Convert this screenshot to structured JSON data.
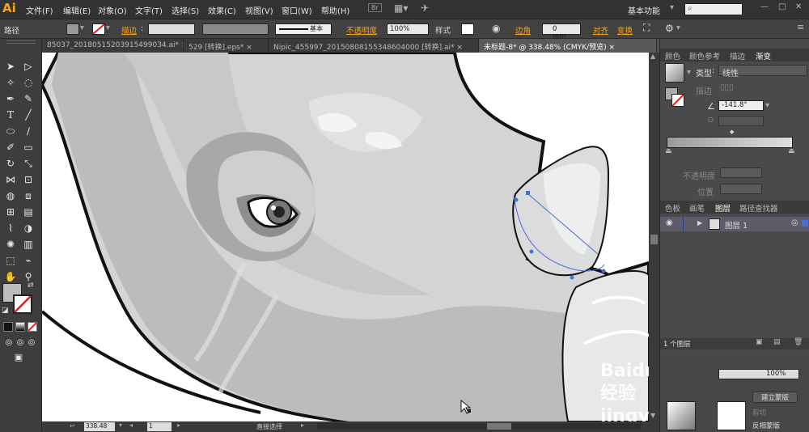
{
  "menubar": {
    "logo": "Ai",
    "items": [
      "文件(F)",
      "编辑(E)",
      "对象(O)",
      "文字(T)",
      "选择(S)",
      "效果(C)",
      "视图(V)",
      "窗口(W)",
      "帮助(H)"
    ],
    "badge": "Br",
    "workspace": "基本功能",
    "search_placeholder": ""
  },
  "control_bar": {
    "selection_label": "路径",
    "stroke_label": "描边",
    "stroke_style": "基本",
    "opacity_label": "不透明度",
    "opacity_value": "100%",
    "style_label": "样式",
    "corner_label": "边角",
    "corner_value": "0 mm",
    "align_label": "对齐",
    "transform_label": "变换"
  },
  "tabs": [
    {
      "label": "85037_20180515203915499034.ai* ×"
    },
    {
      "label": "529 [转换].eps* ×"
    },
    {
      "label": "Nipic_455997_20150808155348604000 [转换].ai* ×"
    },
    {
      "label": "未标题-8* @ 338.48% (CMYK/预览) ×"
    }
  ],
  "gradient_panel": {
    "tabs": [
      "颜色",
      "颜色参考",
      "描边",
      "渐变"
    ],
    "type_label": "类型",
    "type_value": "线性",
    "stroke_label": "描边",
    "angle_value": "-141.8°",
    "opacity_label": "不透明度",
    "position_label": "位置"
  },
  "layers_panel": {
    "tabs": [
      "色板",
      "画笔",
      "图层",
      "路径查找器"
    ],
    "layer_name": "图层 1",
    "count": "1 个图层"
  },
  "transparency_panel": {
    "opacity_value": "100%",
    "mask_button": "建立蒙版",
    "clip_label": "剪切",
    "invert_label": "反相蒙版"
  },
  "status_bar": {
    "zoom": "338.48",
    "page": "1",
    "tool": "直接选择"
  },
  "watermark": "Baidu 经验 jingyan.baidu.com",
  "colors": {
    "accent": "#f7a21b",
    "ui_dark": "#323232",
    "panel": "#4a4a4a",
    "selection": "#4a6fd4"
  }
}
